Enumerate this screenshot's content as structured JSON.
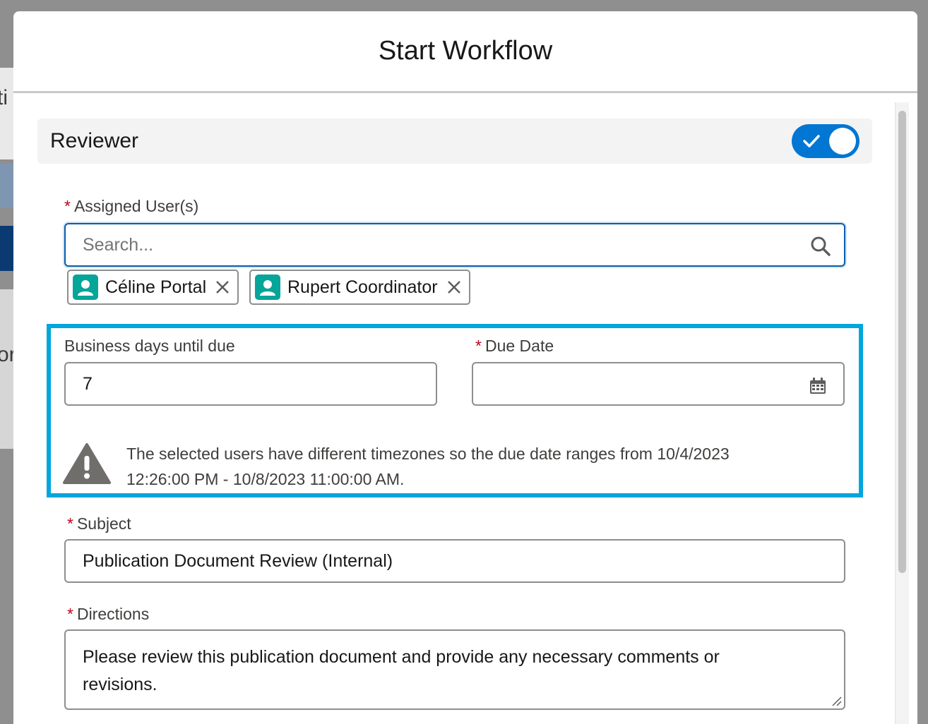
{
  "background": {
    "fragment_1": "ti",
    "fragment_2": "or"
  },
  "modal": {
    "title": "Start Workflow"
  },
  "section": {
    "title": "Reviewer",
    "toggle_on": true,
    "toggle_icon": "check-icon"
  },
  "assigned_users": {
    "label": "Assigned User(s)",
    "required_marker": "*",
    "search_placeholder": "Search...",
    "search_icon": "search-icon",
    "selected": [
      {
        "name": "Céline Portal",
        "icon": "user-avatar-icon"
      },
      {
        "name": "Rupert Coordinator",
        "icon": "user-avatar-icon"
      }
    ]
  },
  "business_days": {
    "label": "Business days until due",
    "value": "7"
  },
  "due_date": {
    "label": "Due Date",
    "required_marker": "*",
    "value": "",
    "icon": "calendar-icon"
  },
  "warning": {
    "icon": "warning-icon",
    "text_line1": "The selected users have different timezones so the due date ranges from 10/4/2023",
    "text_line2": "12:26:00 PM - 10/8/2023 11:00:00 AM."
  },
  "subject": {
    "label": "Subject",
    "required_marker": "*",
    "value": "Publication Document Review (Internal)"
  },
  "directions": {
    "label": "Directions",
    "required_marker": "*",
    "value_line1": "Please review this publication document and provide any necessary comments or",
    "value_line2": "revisions."
  },
  "colors": {
    "brand_blue": "#0176d3",
    "highlight_cyan": "#00a6dd",
    "required_red": "#ba0517",
    "avatar_teal": "#06a59a"
  }
}
